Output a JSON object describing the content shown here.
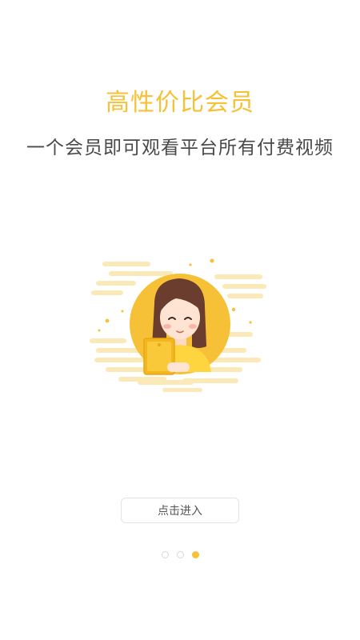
{
  "guide": {
    "title": "高性价比会员",
    "subtitle": "一个会员即可观看平台所有付费视频",
    "enter_button": "点击进入",
    "illustration": "girl-holding-tablet-illustration"
  },
  "pagination": {
    "total": 3,
    "active_index": 2
  },
  "colors": {
    "accent": "#F6C136",
    "text": "#4a4a4a",
    "button_border": "#e3e3e3"
  }
}
